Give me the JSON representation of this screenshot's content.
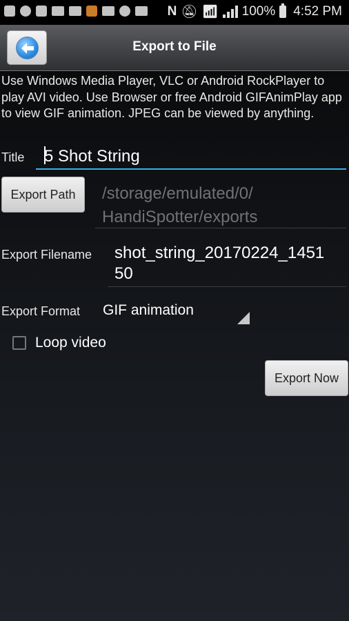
{
  "status_bar": {
    "battery": "100%",
    "time": "4:52 PM"
  },
  "header": {
    "title": "Export to File",
    "back_icon": "left-arrow-icon"
  },
  "description": "Use Windows Media Player, VLC or Android RockPlayer to play AVI video. Use Browser or free Android GIFAnimPlay app to view GIF animation. JPEG can be viewed by anything.",
  "form": {
    "title_label": "Title",
    "title_value": "5 Shot String",
    "export_path_button": "Export Path",
    "export_path_line1": "/storage/emulated/0/",
    "export_path_line2": "HandiSpotter/exports",
    "filename_label": "Export Filename",
    "filename_line1": "shot_string_20170224_1451",
    "filename_line2": "50",
    "format_label": "Export Format",
    "format_value": "GIF animation",
    "loop_label": "Loop video",
    "loop_checked": false,
    "export_now_button": "Export Now"
  },
  "colors": {
    "accent": "#33b5e5"
  }
}
